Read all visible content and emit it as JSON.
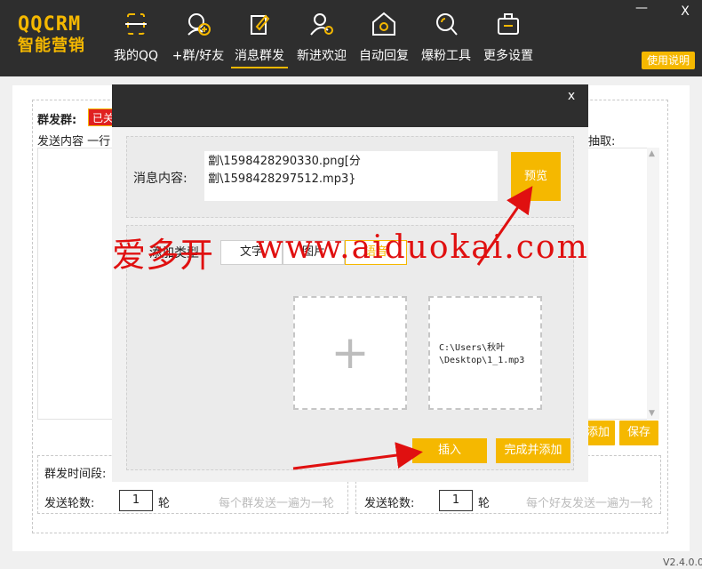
{
  "app": {
    "logo_line1": "QQCRM",
    "logo_line2": "智能营销",
    "window_min": "—",
    "window_close": "X",
    "help_label": "使用说明",
    "version": "V2.4.0.0",
    "accent_color": "#f5b800",
    "nav": [
      {
        "label": "我的QQ",
        "icon": "qq-scan-icon"
      },
      {
        "label": "+群/好友",
        "icon": "add-contact-icon"
      },
      {
        "label": "消息群发",
        "icon": "message-edit-icon",
        "active": true
      },
      {
        "label": "新进欢迎",
        "icon": "welcome-user-icon"
      },
      {
        "label": "自动回复",
        "icon": "auto-reply-icon"
      },
      {
        "label": "爆粉工具",
        "icon": "search-fans-icon"
      },
      {
        "label": "更多设置",
        "icon": "toolbox-icon"
      }
    ]
  },
  "background": {
    "group_label": "群发群:",
    "group_tag": "已关",
    "send_content_label": "发送内容 一行",
    "extract_label": "抽取:",
    "add_btn": "添加",
    "save_btn": "保存",
    "interval_label": "群发时间段:",
    "left_rounds_label": "发送轮数:",
    "left_rounds_value": "1",
    "left_rounds_unit": "轮",
    "left_hint": "每个群发送一遍为一轮",
    "right_rounds_label": "发送轮数:",
    "right_rounds_value": "1",
    "right_rounds_unit": "轮",
    "right_hint": "每个好友发送一遍为一轮"
  },
  "modal": {
    "close": "x",
    "message_label": "消息内容:",
    "message_text": "劏\\1598428290330.png[分\n劏\\1598428297512.mp3}",
    "preview_btn": "预览",
    "add_type_label": "添加类型",
    "type_tabs": [
      "文字",
      "图片",
      "语音"
    ],
    "selected_type": "语音",
    "plus_symbol": "+",
    "file_path": "C:\\Users\\秋叶\n\\Desktop\\1_1.mp3",
    "insert_btn": "插入",
    "finish_btn": "完成并添加"
  },
  "watermark": {
    "left": "爱多开",
    "right": "www.aiduokai.com",
    "color": "#e01010"
  }
}
